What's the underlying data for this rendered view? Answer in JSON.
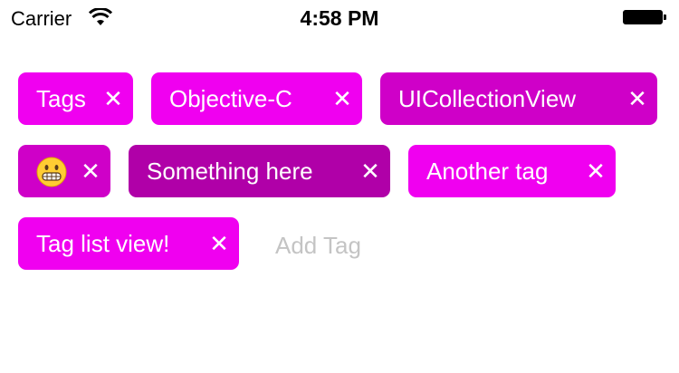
{
  "status_bar": {
    "carrier": "Carrier",
    "time": "4:58 PM"
  },
  "colors": {
    "tag_bright": "#f000f0",
    "tag_medium": "#cf00c8",
    "tag_dark": "#b000a8",
    "placeholder": "#c4c4c4"
  },
  "tags": [
    {
      "label": "Tags",
      "close": "✕"
    },
    {
      "label": "Objective-C",
      "close": "✕"
    },
    {
      "label": "UICollectionView",
      "close": "✕"
    },
    {
      "label": "",
      "icon": "grimacing-face-emoji",
      "close": "✕"
    },
    {
      "label": "Something here",
      "close": "✕"
    },
    {
      "label": "Another tag",
      "close": "✕"
    },
    {
      "label": "Tag list view!",
      "close": "✕"
    }
  ],
  "input": {
    "placeholder": "Add Tag",
    "value": ""
  }
}
